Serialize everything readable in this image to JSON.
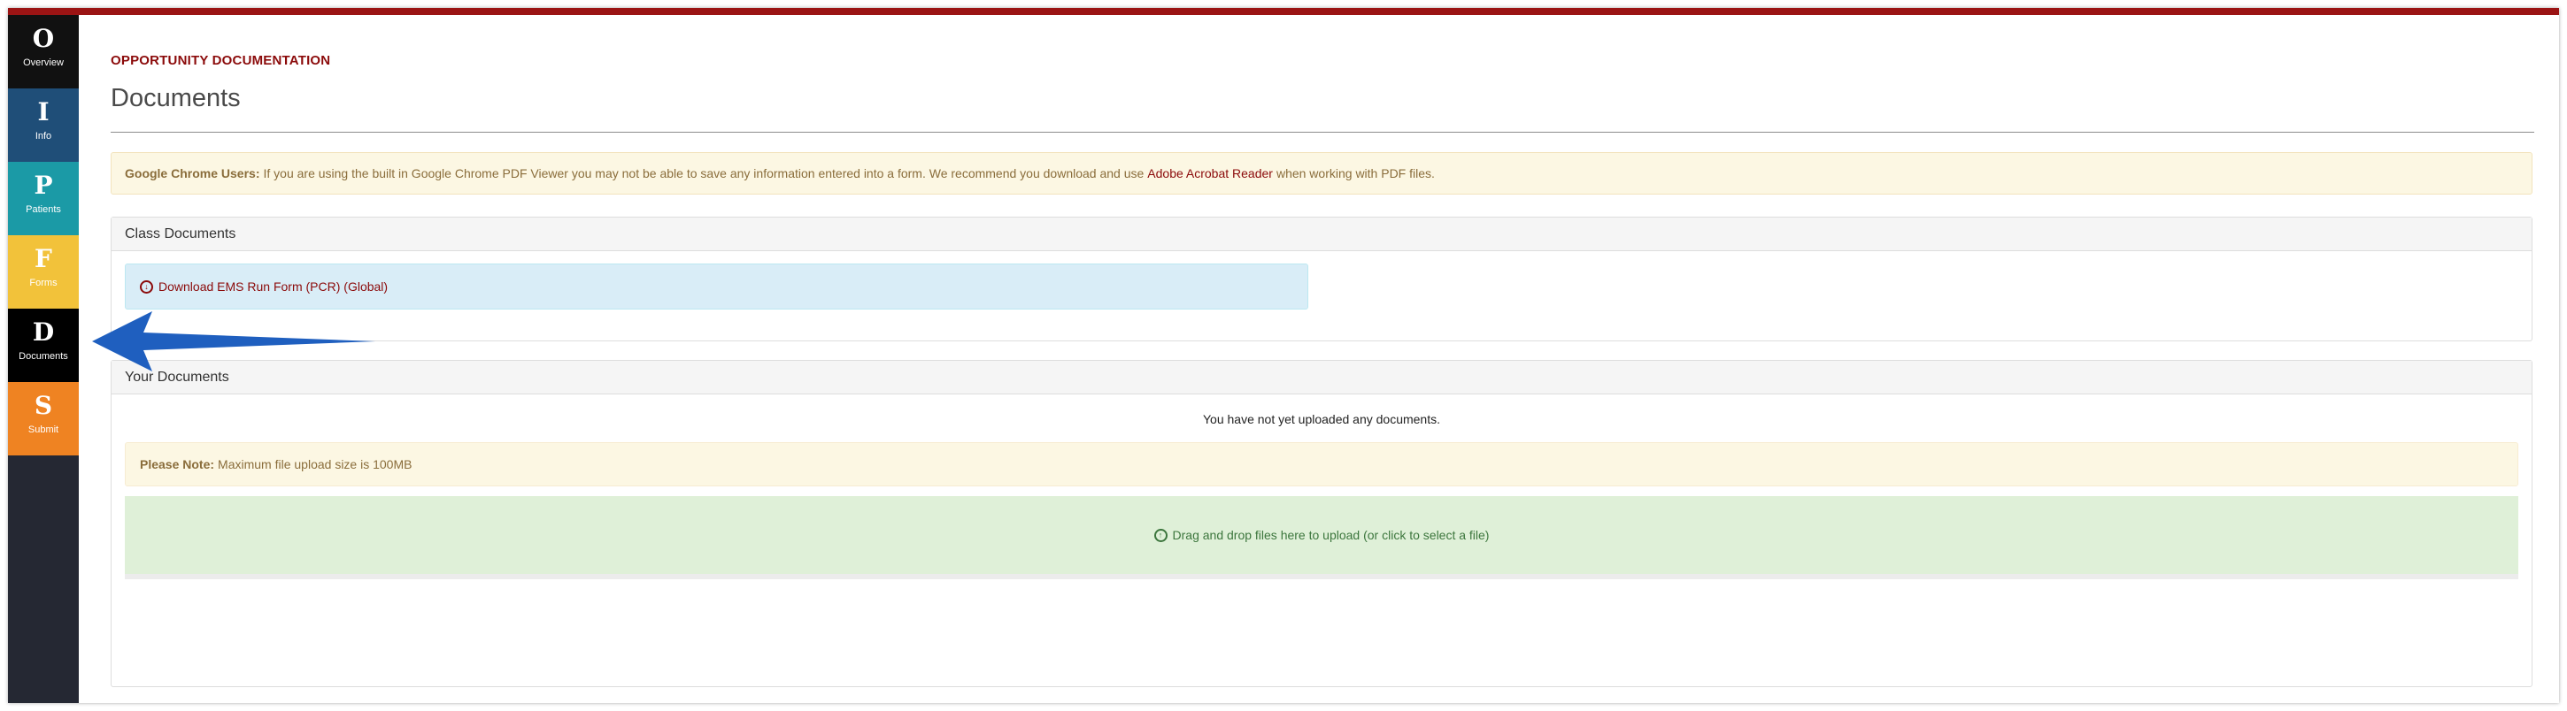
{
  "sidebar": {
    "items": [
      {
        "letter": "O",
        "label": "Overview",
        "color": "#111111"
      },
      {
        "letter": "I",
        "label": "Info",
        "color": "#1f4e78"
      },
      {
        "letter": "P",
        "label": "Patients",
        "color": "#1b9aa6"
      },
      {
        "letter": "F",
        "label": "Forms",
        "color": "#f2c23a"
      },
      {
        "letter": "D",
        "label": "Documents",
        "color": "#000000",
        "active": true
      },
      {
        "letter": "S",
        "label": "Submit",
        "color": "#ef8322"
      }
    ]
  },
  "header": {
    "eyebrow": "OPPORTUNITY DOCUMENTATION",
    "title": "Documents"
  },
  "chrome_alert": {
    "bold": "Google Chrome Users:",
    "text_before": "If you are using the built in Google Chrome PDF Viewer you may not be able to save any information entered into a form. We recommend you download and use",
    "link": "Adobe Acrobat Reader",
    "text_after": "when working with PDF files."
  },
  "class_documents": {
    "heading": "Class Documents",
    "download_label": "Download EMS Run Form (PCR) (Global)",
    "download_icon": "download-circle-icon"
  },
  "your_documents": {
    "heading": "Your Documents",
    "empty_message": "You have not yet uploaded any documents.",
    "note_bold": "Please Note:",
    "note_text": "Maximum file upload size is 100MB",
    "dropzone_label": "Drag and drop files here to upload (or click to select a file)",
    "dropzone_icon": "upload-circle-icon"
  },
  "colors": {
    "accent": "#8b0a0a",
    "annotation_arrow": "#1f5fbf"
  }
}
